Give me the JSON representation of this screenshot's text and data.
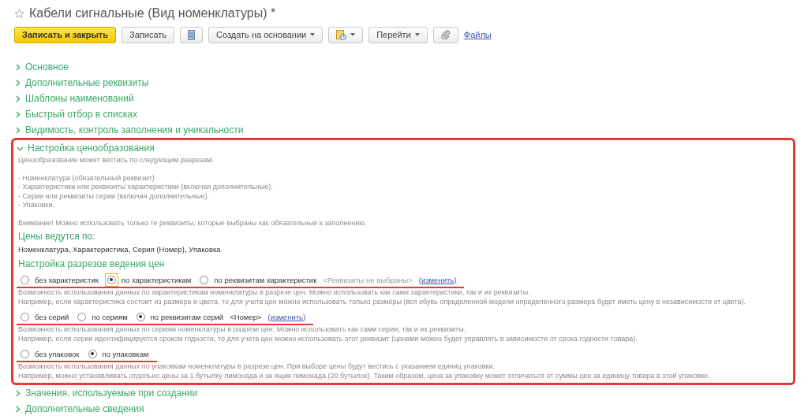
{
  "window": {
    "title": "Кабели сигнальные (Вид номенклатуры) *",
    "favorite": false
  },
  "toolbar": [
    {
      "kind": "primary",
      "label": "Записать и закрыть"
    },
    {
      "kind": "button",
      "label": "Записать"
    },
    {
      "kind": "document"
    },
    {
      "kind": "menu",
      "label": "Создать на основании"
    },
    {
      "kind": "report"
    },
    {
      "kind": "menu",
      "label": "Перейти"
    },
    {
      "kind": "attach"
    },
    {
      "kind": "link",
      "label": "Файлы"
    }
  ],
  "sections": [
    {
      "label": "Основное",
      "expanded": false
    },
    {
      "label": "Дополнительные реквизиты",
      "expanded": false
    },
    {
      "label": "Шаблоны наименований",
      "expanded": false
    },
    {
      "label": "Быстрый отбор в списках",
      "expanded": false
    },
    {
      "label": "Видимость, контроль заполнения и уникальности",
      "expanded": false
    },
    {
      "label": "Настройка ценообразования",
      "expanded": true,
      "highlighted": true,
      "content": {
        "intro": "Ценообразование может вестись по следующим разрезам:",
        "bullets": [
          "- Номенклатура (обязательный реквизит)",
          "- Характеристики или реквизиты характеристики (включая дополнительные).",
          "- Серии или реквизиты серии (включая дополнительные).",
          "- Упаковки."
        ],
        "note": "Внимание! Можно использовать только те реквизиты, которые выбраны как обязательные к заполнению.",
        "prices_heading": "Цены ведутся по:",
        "prices_value": "Номенклатура, Характеристика, Серия (Номер), Упаковка",
        "settings_heading": "Настройка разрезов ведения цен",
        "groups": [
          {
            "underlined": true,
            "options": [
              {
                "label": "без характеристик",
                "selected": false,
                "focused": false
              },
              {
                "label": "по характеристикам",
                "selected": true,
                "focused": true
              },
              {
                "label": "по реквизитам характеристик",
                "selected": false,
                "focused": false
              }
            ],
            "value": "<Реквизиты не выбраны>",
            "value_muted": true,
            "link": "(изменить)",
            "description": [
              "Возможность использования данных по характеристикам номенклатуры в разрезе цен. Можно использовать как сами характеристики, так и их реквизиты.",
              "Например, если характеристика состоит из размера и цвета, то для учета цен можно использовать только размеры (вся обувь определенной модели определенного размера будет иметь цену в независимости от цвета)."
            ]
          },
          {
            "underlined": true,
            "options": [
              {
                "label": "без серий",
                "selected": false,
                "focused": false
              },
              {
                "label": "по сериям",
                "selected": false,
                "focused": false
              },
              {
                "label": "по реквизитам серий",
                "selected": true,
                "focused": false
              }
            ],
            "value": "<Номер>",
            "value_muted": false,
            "link": "(изменить)",
            "description": [
              "Возможность использования данных по сериям номенклатуры в разрезе цен. Можно использовать как сами серии, так и их реквизиты.",
              "Например, если серии идентифицируется сроком годности, то для учета цен можно использовать этот реквизит (ценами можно будет управлять в зависимости от срока годности товара)."
            ]
          },
          {
            "underlined": true,
            "options": [
              {
                "label": "без упаковок",
                "selected": false,
                "focused": false
              },
              {
                "label": "по упаковкам",
                "selected": true,
                "focused": false
              }
            ],
            "description": [
              "Возможность использования данных по упаковкам номенклатуры в разрезе цен. При выборе цены будут вестись с указанием единиц упаковки.",
              "Например, можно устанавливать отдельно цены за 1 бутылку лимонада и за ящик лимонада (20 бутылок). Таким образом, цена за упаковку может отличаться от суммы цен за единицу товара в этой упаковке."
            ]
          }
        ]
      }
    },
    {
      "label": "Значения, используемые при создании",
      "expanded": false
    },
    {
      "label": "Дополнительные сведения",
      "expanded": false
    }
  ]
}
